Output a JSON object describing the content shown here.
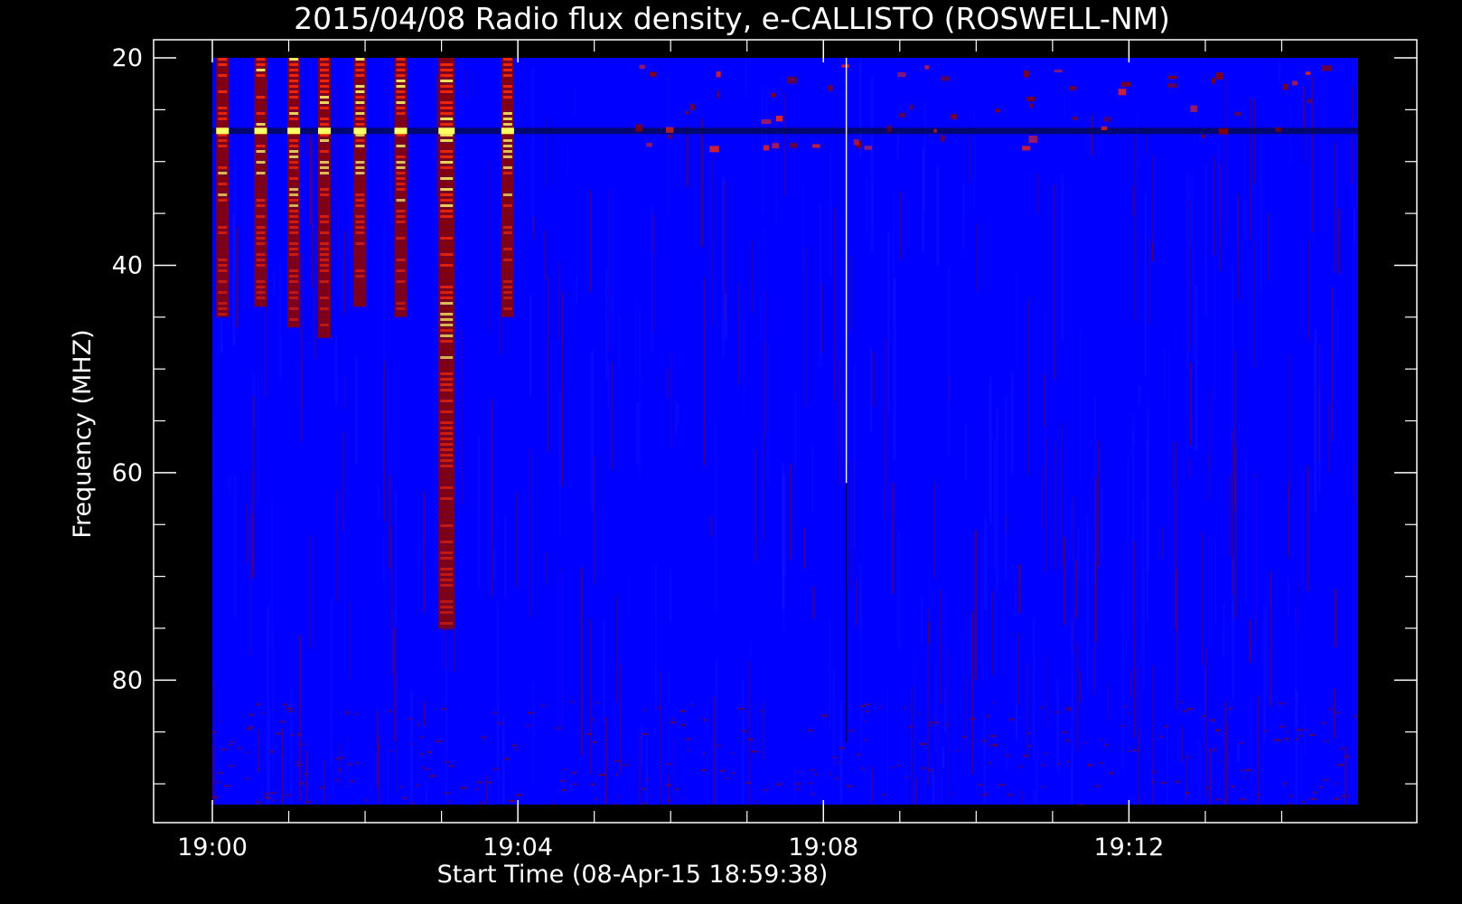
{
  "chart_data": {
    "type": "heatmap",
    "title": "2015/04/08  Radio flux density, e-CALLISTO (ROSWELL-NM)",
    "xlabel": "Start Time (08-Apr-15 18:59:38)",
    "ylabel": "Frequency (MHZ)",
    "x_start_minutes_after_1900": 0,
    "x_end_minutes_after_1900": 15,
    "ylim": [
      20,
      92
    ],
    "x_ticks": [
      "19:00",
      "19:04",
      "19:08",
      "19:12"
    ],
    "y_ticks": [
      20,
      40,
      60,
      80
    ],
    "colormap": "blue-red-yellow",
    "colors": {
      "background": "#0000ff",
      "low": "#1a1aff",
      "mid": "#8b0000",
      "high": "#ff2a00",
      "peak": "#ffff66",
      "band_dark": "#000a40"
    },
    "bursts": [
      {
        "time": "19:00:08",
        "freq_top": 20,
        "freq_bottom": 45
      },
      {
        "time": "19:00:38",
        "freq_top": 20,
        "freq_bottom": 44
      },
      {
        "time": "19:01:04",
        "freq_top": 20,
        "freq_bottom": 46
      },
      {
        "time": "19:01:28",
        "freq_top": 20,
        "freq_bottom": 47
      },
      {
        "time": "19:01:56",
        "freq_top": 20,
        "freq_bottom": 44
      },
      {
        "time": "19:02:28",
        "freq_top": 20,
        "freq_bottom": 45
      },
      {
        "time": "19:03:04",
        "freq_top": 20,
        "freq_bottom": 75
      },
      {
        "time": "19:03:52",
        "freq_top": 20,
        "freq_bottom": 45
      }
    ],
    "dark_band_freq_mhz": 27,
    "spike_time": "19:08:18"
  }
}
